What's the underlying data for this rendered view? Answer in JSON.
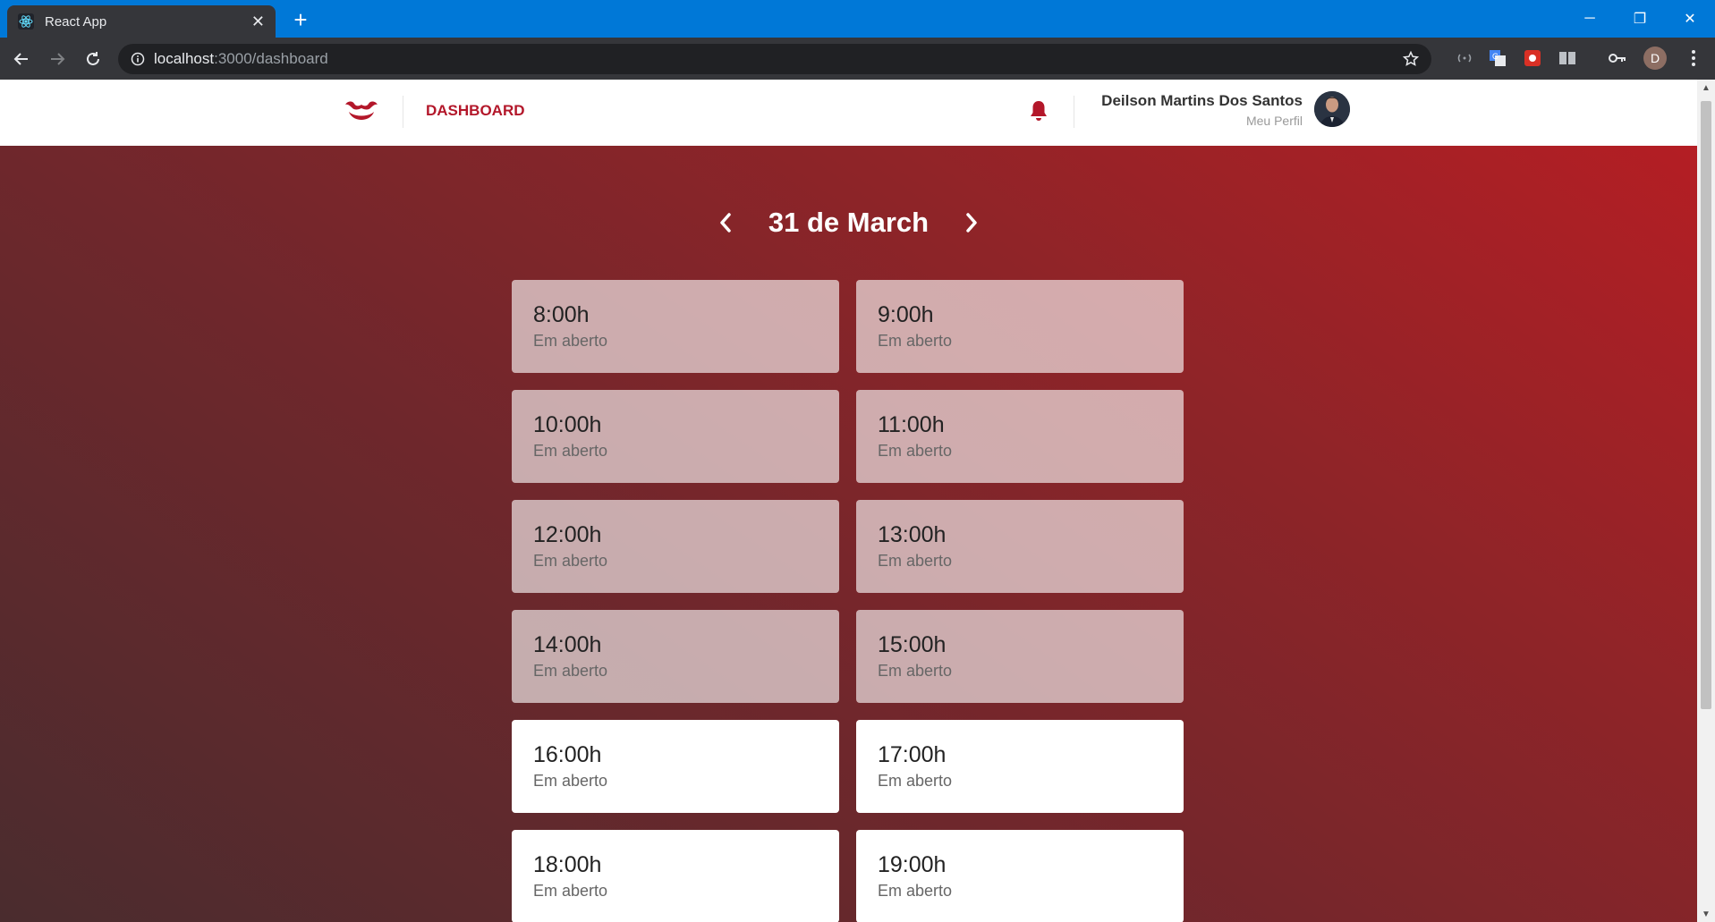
{
  "browser": {
    "tab_title": "React App",
    "url_host": "localhost",
    "url_rest": ":3000/dashboard",
    "profile_initial": "D"
  },
  "header": {
    "brand": "DASHBOARD",
    "user_name": "Deilson Martins Dos Santos",
    "profile_link": "Meu Perfil"
  },
  "date_nav": {
    "title": "31 de March"
  },
  "slots": [
    {
      "time": "8:00h",
      "status": "Em aberto",
      "state": "past"
    },
    {
      "time": "9:00h",
      "status": "Em aberto",
      "state": "past"
    },
    {
      "time": "10:00h",
      "status": "Em aberto",
      "state": "past"
    },
    {
      "time": "11:00h",
      "status": "Em aberto",
      "state": "past"
    },
    {
      "time": "12:00h",
      "status": "Em aberto",
      "state": "past"
    },
    {
      "time": "13:00h",
      "status": "Em aberto",
      "state": "past"
    },
    {
      "time": "14:00h",
      "status": "Em aberto",
      "state": "past"
    },
    {
      "time": "15:00h",
      "status": "Em aberto",
      "state": "past"
    },
    {
      "time": "16:00h",
      "status": "Em aberto",
      "state": "open"
    },
    {
      "time": "17:00h",
      "status": "Em aberto",
      "state": "open"
    },
    {
      "time": "18:00h",
      "status": "Em aberto",
      "state": "open"
    },
    {
      "time": "19:00h",
      "status": "Em aberto",
      "state": "open"
    }
  ],
  "colors": {
    "brand_red": "#b3172a",
    "titlebar_blue": "#0078d7"
  }
}
